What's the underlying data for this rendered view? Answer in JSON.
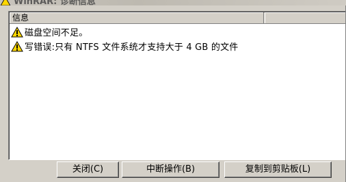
{
  "window": {
    "title": "WinRAR: 诊断信息",
    "title_icon": "warning-icon"
  },
  "list": {
    "column_header": "信息",
    "rows": [
      {
        "icon": "warning-icon",
        "message": "磁盘空间不足。"
      },
      {
        "icon": "warning-icon",
        "message": "写错误:只有 NTFS 文件系统才支持大于 4 GB 的文件"
      }
    ]
  },
  "buttons": {
    "close_label": "关闭(C)",
    "abort_label": "中断操作(B)",
    "copy_label": "复制到剪贴板(L)"
  },
  "colors": {
    "dialog_bg": "#d4d0c8",
    "list_bg": "#ffffff",
    "warning_yellow": "#ffd700"
  }
}
